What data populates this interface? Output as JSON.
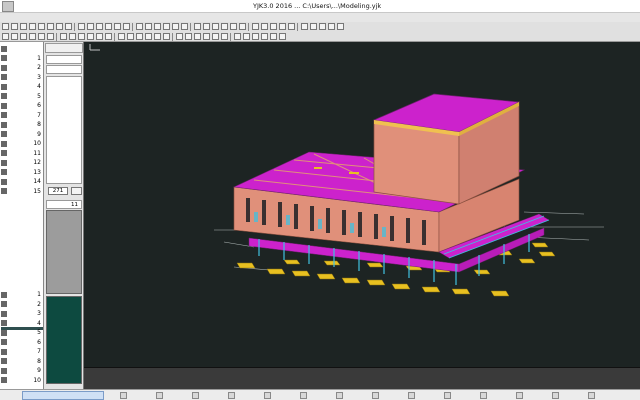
{
  "window": {
    "title": "YJK3.0 2016 ... C:\\Users\\...\\Modeling.yjk"
  },
  "menu": {
    "items": [
      "",
      "",
      "",
      "",
      "",
      "",
      "",
      "",
      "",
      "",
      "",
      "",
      "",
      "",
      "",
      "",
      "",
      ""
    ]
  },
  "left_panel": {
    "rows": [
      {
        "label": "",
        "num": ""
      },
      {
        "label": "",
        "num": "1"
      },
      {
        "label": "",
        "num": "2"
      },
      {
        "label": "",
        "num": "3"
      },
      {
        "label": "",
        "num": "4"
      },
      {
        "label": "",
        "num": "5"
      },
      {
        "label": "",
        "num": "6"
      },
      {
        "label": "",
        "num": "7"
      },
      {
        "label": "",
        "num": "8"
      },
      {
        "label": "",
        "num": "9"
      },
      {
        "label": "",
        "num": "10"
      },
      {
        "label": "",
        "num": "11"
      },
      {
        "label": "",
        "num": "12"
      },
      {
        "label": "",
        "num": "13"
      },
      {
        "label": "",
        "num": "14"
      },
      {
        "label": "",
        "num": "15"
      }
    ],
    "bottom_rows": [
      {
        "label": "",
        "num": "1"
      },
      {
        "label": "",
        "num": "2"
      },
      {
        "label": "",
        "num": "3"
      },
      {
        "label": "",
        "num": "4"
      },
      {
        "label": "",
        "num": "5"
      },
      {
        "label": "",
        "num": "6"
      },
      {
        "label": "",
        "num": "7"
      },
      {
        "label": "",
        "num": "8"
      },
      {
        "label": "",
        "num": "9"
      },
      {
        "label": "",
        "num": "10"
      }
    ]
  },
  "mid_panel": {
    "field_value": "271",
    "prop_num": "11"
  },
  "viewport": {
    "title": ""
  },
  "command": {
    "line1": "",
    "line2": ""
  },
  "status": {
    "coord": "",
    "taskbar_app": ""
  },
  "colors": {
    "viewport_bg": "#1d2423",
    "slab_magenta": "#cc22cc",
    "wall_salmon": "#e0907a",
    "foundation_yellow": "#e8c020",
    "beam_cyan": "#40c0e0"
  }
}
